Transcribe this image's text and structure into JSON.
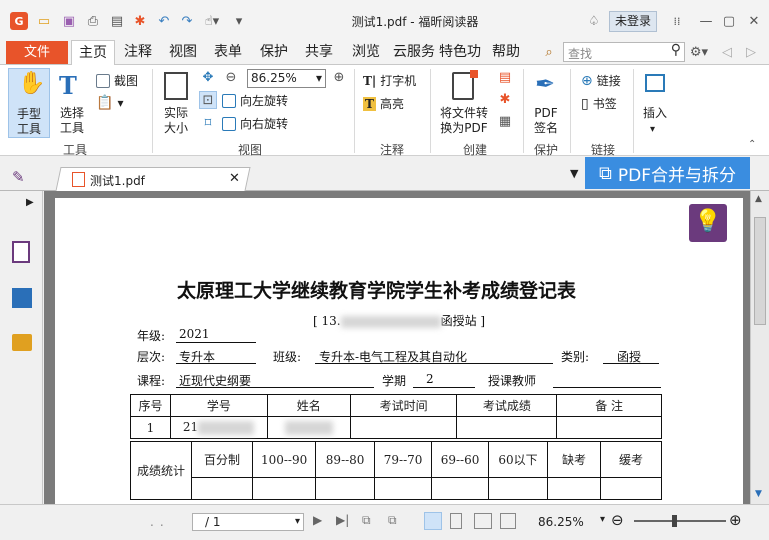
{
  "title": "测试1.pdf - 福昕阅读器",
  "login_label": "未登录",
  "menu": {
    "file": "文件",
    "tabs": [
      "主页",
      "注释",
      "视图",
      "表单",
      "保护",
      "共享",
      "浏览",
      "云服务",
      "特色功能",
      "帮助"
    ],
    "search_placeholder": "查找"
  },
  "ribbon": {
    "hand": "手型\n工具",
    "select": "选择\n工具",
    "screenshot": "截图",
    "actual": "实际\n大小",
    "zoom": "86.25%",
    "rotate_left": "向左旋转",
    "rotate_right": "向右旋转",
    "typewriter": "打字机",
    "highlight": "高亮",
    "to_pdf": "将文件转\n换为PDF",
    "pdf_sign": "PDF\n签名",
    "link": "链接",
    "bookmark": "书签",
    "insert": "插入",
    "groups": [
      "工具",
      "视图",
      "注释",
      "创建",
      "保护",
      "链接"
    ]
  },
  "doc_tab": "测试1.pdf",
  "merge_label": "PDF合并与拆分",
  "document": {
    "heading": "太原理工大学继续教育学院学生补考成绩登记表",
    "station_prefix": "[ 13.",
    "station_suffix": "函授站 ]",
    "grade_label": "年级:",
    "grade_value": "2021",
    "level_label": "层次:",
    "level_value": "专升本",
    "major_label": "班级:",
    "major_value": "专升本-电气工程及其自动化",
    "type_label": "类别:",
    "type_value": "函授",
    "course_label": "课程:",
    "course_value": "近现代史纲要",
    "term_label": "学期",
    "term_value": "2",
    "teacher_label": "授课教师",
    "table_headers": [
      "序号",
      "学号",
      "姓名",
      "考试时间",
      "考试成绩",
      "备  注"
    ],
    "row1": {
      "index": "1",
      "id_prefix": "21"
    },
    "stats_label": "成绩统计",
    "stats_headers": [
      "百分制",
      "100--90",
      "89--80",
      "79--70",
      "69--60",
      "60以下",
      "缺考",
      "缓考"
    ]
  },
  "status": {
    "page": "/ 1",
    "zoom": "86.25%"
  },
  "colors": {
    "accent": "#e8542a",
    "merge": "#3a8de0",
    "bulb": "#6b3a7d"
  }
}
